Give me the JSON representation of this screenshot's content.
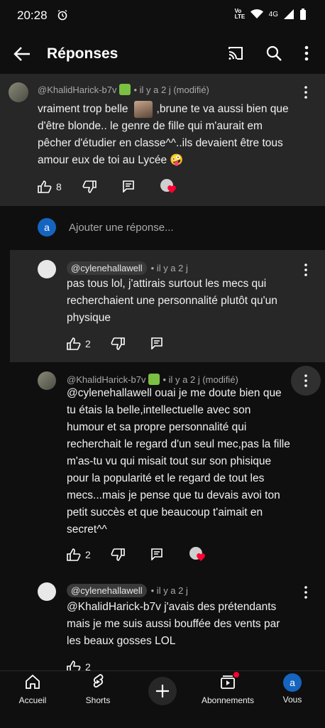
{
  "status_bar": {
    "time": "20:28",
    "net": "4G",
    "volte": "Vo LTE"
  },
  "appbar": {
    "title": "Réponses"
  },
  "main_comment": {
    "username": "@KhalidHarick-b7v",
    "meta": "• il y a 2 j (modifié)",
    "text_lines": [
      "vraiment trop belle",
      ",brune te va aussi bien que",
      "d'être blonde.. le genre de fille qui m'aurait em",
      "pêcher d'étudier en classe^^..ils devaient être tous",
      "amour eux de toi au Lycée 🤪"
    ],
    "likes": "8"
  },
  "add_reply": {
    "avatar_letter": "a",
    "placeholder": "Ajouter une réponse..."
  },
  "replies": [
    {
      "username": "@cylenehallawell",
      "meta": "• il y a 2 j",
      "text_lines": [
        "pas tous lol, j'attirais surtout les mecs qui",
        "recherchaient une personnalité plutôt qu'un",
        "physique"
      ],
      "likes": "2"
    },
    {
      "username": "@KhalidHarick-b7v",
      "meta": "• il y a 2 j (modifié)",
      "text_lines": [
        "@cylenehallawell  ouai je me doute bien que",
        "tu étais la belle,intellectuelle avec son",
        "humour et sa propre personnalité qui",
        "recherchait le regard d'un seul mec,pas la fille",
        "m'as-tu vu qui misait tout sur son phisique",
        "pour la popularité et le regard de tout les",
        "mecs...mais je pense que tu devais avoi ton",
        "petit succès et que beaucoup t'aimait en",
        "secret^^"
      ],
      "likes": "2"
    },
    {
      "username": "@cylenehallawell",
      "meta": "• il y a 2 j",
      "text_lines": [
        "@KhalidHarick-b7v  j'avais des prétendants",
        "mais je me suis aussi bouffée des vents par",
        "les beaux gosses LOL"
      ],
      "likes": "2"
    }
  ],
  "bottom_nav": {
    "home": "Accueil",
    "shorts": "Shorts",
    "subs": "Abonnements",
    "you": "Vous",
    "you_letter": "a"
  },
  "colors": {
    "accent_blue": "#1565c0",
    "notif_red": "#ff0033",
    "panel": "#272727"
  }
}
